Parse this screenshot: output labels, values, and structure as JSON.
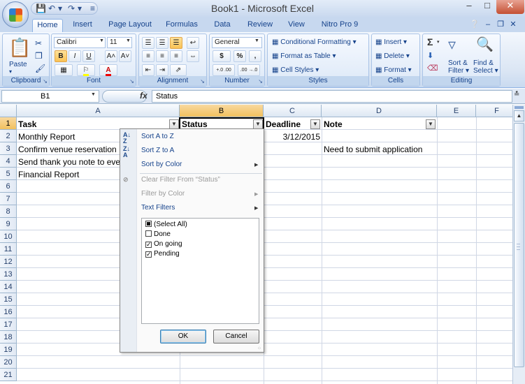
{
  "titlebar": {
    "title": "Book1 - Microsoft Excel",
    "minimize": "–",
    "restore": "□",
    "close": "✕"
  },
  "qat": {
    "save_icon": "save-icon",
    "undo_icon": "undo-icon",
    "redo_icon": "redo-icon"
  },
  "tabs": [
    {
      "label": "Home",
      "active": true
    },
    {
      "label": "Insert"
    },
    {
      "label": "Page Layout"
    },
    {
      "label": "Formulas"
    },
    {
      "label": "Data"
    },
    {
      "label": "Review"
    },
    {
      "label": "View"
    },
    {
      "label": "Nitro Pro 9"
    }
  ],
  "ribbon": {
    "clipboard": {
      "label": "Clipboard",
      "paste": "Paste"
    },
    "font": {
      "label": "Font",
      "name": "Calibri",
      "size": "11",
      "bold": "B",
      "italic": "I",
      "underline": "U",
      "grow": "A˄",
      "shrink": "A˅",
      "font_color": "A"
    },
    "alignment": {
      "label": "Alignment"
    },
    "number": {
      "label": "Number",
      "format": "General",
      "currency": "$",
      "percent": "%",
      "comma": ",",
      "inc_dec": "+.0 .00",
      "dec_dec": ".00 →.0"
    },
    "styles": {
      "label": "Styles",
      "conditional": "Conditional Formatting",
      "table": "Format as Table",
      "cell_styles": "Cell Styles"
    },
    "cells": {
      "label": "Cells",
      "insert": "Insert",
      "delete": "Delete",
      "format": "Format"
    },
    "editing": {
      "label": "Editing",
      "sigma": "Σ",
      "sort": "Sort &",
      "sort2": "Filter",
      "find": "Find &",
      "find2": "Select"
    }
  },
  "formula_bar": {
    "name_box": "B1",
    "fx": "fx",
    "content": "Status"
  },
  "grid": {
    "columns": [
      "A",
      "B",
      "C",
      "D",
      "E",
      "F"
    ],
    "rows": [
      "1",
      "2",
      "3",
      "4",
      "5",
      "6",
      "7",
      "8",
      "9",
      "10",
      "11",
      "12",
      "13",
      "14",
      "15",
      "16",
      "17",
      "18",
      "19",
      "20",
      "21"
    ],
    "cells": {
      "A1": "Task",
      "B1": "Status",
      "C1": "Deadline",
      "D1": "Note",
      "A2": "Monthly Report",
      "C2": "3/12/2015",
      "A3": "Confirm venue reservation",
      "D3": "Need to submit application",
      "A4": "Send thank you note to eve",
      "A5": "Financial Report"
    }
  },
  "filter_menu": {
    "sort_az": "Sort A to Z",
    "sort_za": "Sort Z to A",
    "sort_color": "Sort by Color",
    "clear_filter": "Clear Filter From “Status”",
    "filter_color": "Filter by Color",
    "text_filters": "Text Filters",
    "items": [
      {
        "label": "(Select All)",
        "state": "partial"
      },
      {
        "label": "Done",
        "state": "unchecked"
      },
      {
        "label": "On going",
        "state": "checked"
      },
      {
        "label": "Pending",
        "state": "checked"
      }
    ],
    "ok": "OK",
    "cancel": "Cancel"
  }
}
